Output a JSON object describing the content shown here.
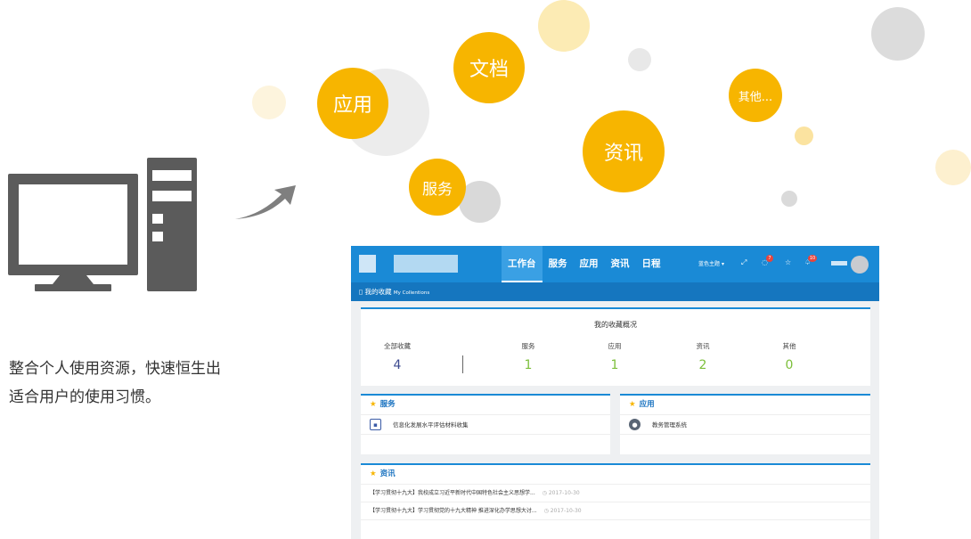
{
  "bubbles": {
    "app": "应用",
    "doc": "文档",
    "news": "资讯",
    "service": "服务",
    "other": "其他..."
  },
  "tagline": {
    "line1": "整合个人使用资源，快速恒生出",
    "line2": "适合用户的使用习惯。"
  },
  "screenshot": {
    "nav": [
      "工作台",
      "服务",
      "应用",
      "资讯",
      "日程"
    ],
    "theme_label": "蓝色主题",
    "notice_count": "7",
    "message_count": "10",
    "subbar": {
      "title": "我的收藏",
      "title_en": "My Collentions"
    },
    "overview": {
      "title": "我的收藏概况",
      "stats": [
        {
          "label": "全部收藏",
          "value": "4"
        },
        {
          "label": "服务",
          "value": "1"
        },
        {
          "label": "应用",
          "value": "1"
        },
        {
          "label": "资讯",
          "value": "2"
        },
        {
          "label": "其他",
          "value": "0"
        }
      ]
    },
    "service_card": {
      "title": "服务",
      "item": "信息化发展水平评估材料收集"
    },
    "app_card": {
      "title": "应用",
      "item": "教务管理系统"
    },
    "news_card": {
      "title": "资讯",
      "items": [
        {
          "title": "【学习贯彻十九大】我校成立习近平新时代中国特色社会主义思想学...",
          "date": "2017-10-30"
        },
        {
          "title": "【学习贯彻十九大】学习贯彻党的十九大精神 推进深化办学思想大讨...",
          "date": "2017-10-30"
        }
      ]
    }
  },
  "colors": {
    "bubble_yellow": "#f7b500",
    "header_blue": "#1a8ad6",
    "stat_total": "#3d4a8f",
    "stat_green": "#7cbf3a"
  }
}
